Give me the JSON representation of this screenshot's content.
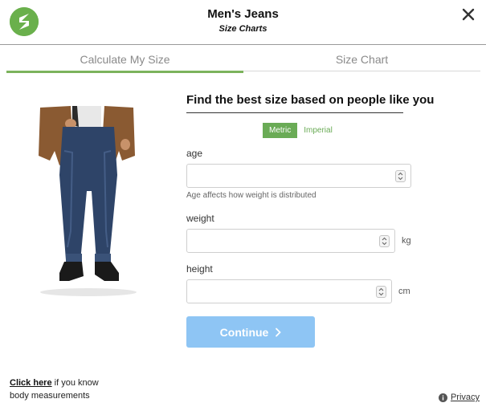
{
  "header": {
    "title": "Men's Jeans",
    "subtitle": "Size Charts",
    "logo_icon": "sizing-app-logo",
    "close_icon": "close-icon"
  },
  "tabs": [
    {
      "label": "Calculate My Size",
      "active": true
    },
    {
      "label": "Size Chart",
      "active": false
    }
  ],
  "form": {
    "heading": "Find the best size based on people like you",
    "units": {
      "metric": "Metric",
      "imperial": "Imperial",
      "selected": "Metric"
    },
    "fields": {
      "age": {
        "label": "age",
        "value": "",
        "hint": "Age affects how weight is distributed"
      },
      "weight": {
        "label": "weight",
        "value": "",
        "unit": "kg"
      },
      "height": {
        "label": "height",
        "value": "",
        "unit": "cm"
      }
    },
    "continue_label": "Continue"
  },
  "footer": {
    "click_here": "Click here",
    "measure_line1": " if you know",
    "measure_line2": "body measurements",
    "privacy": "Privacy"
  },
  "colors": {
    "accent_green": "#6aab56",
    "continue_blue": "#8ec5f4"
  }
}
